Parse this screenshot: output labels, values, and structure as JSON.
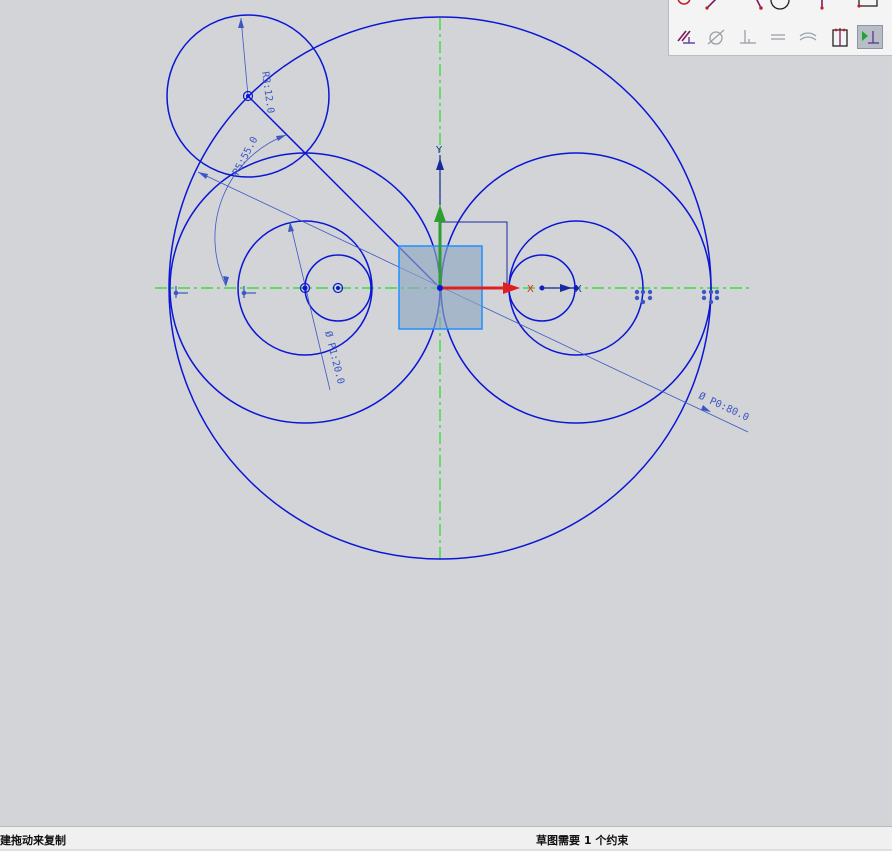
{
  "sketch": {
    "dimensions": {
      "radius_small": "R3:12.0",
      "angle": "P5:55.0",
      "dia_inner": "Ø P1:20.0",
      "dia_outer": "Ø P0:80.0"
    },
    "axis_labels": {
      "x": "X",
      "y": "Y"
    }
  },
  "toolbar": {
    "row1": [
      "fillet-icon",
      "line-icon",
      "point-on-curve-icon",
      "circle-icon",
      "vertical-line-icon",
      "rectangle-icon"
    ],
    "row2": [
      "parallel-icon",
      "tangent-icon",
      "perpendicular-icon",
      "equal-length-icon",
      "concentric-icon",
      "midpoint-icon",
      "show-constraints-icon"
    ]
  },
  "status": {
    "left": "建拖动来复制",
    "center": "草图需要 1 个约束"
  },
  "colors": {
    "curve": "#0a16d4",
    "axis_dashed": "#22dd22",
    "x_axis": "#e02020",
    "y_axis": "#2e9e2e",
    "dimension": "#3c57c4",
    "csys_box": "#1e90ff"
  }
}
